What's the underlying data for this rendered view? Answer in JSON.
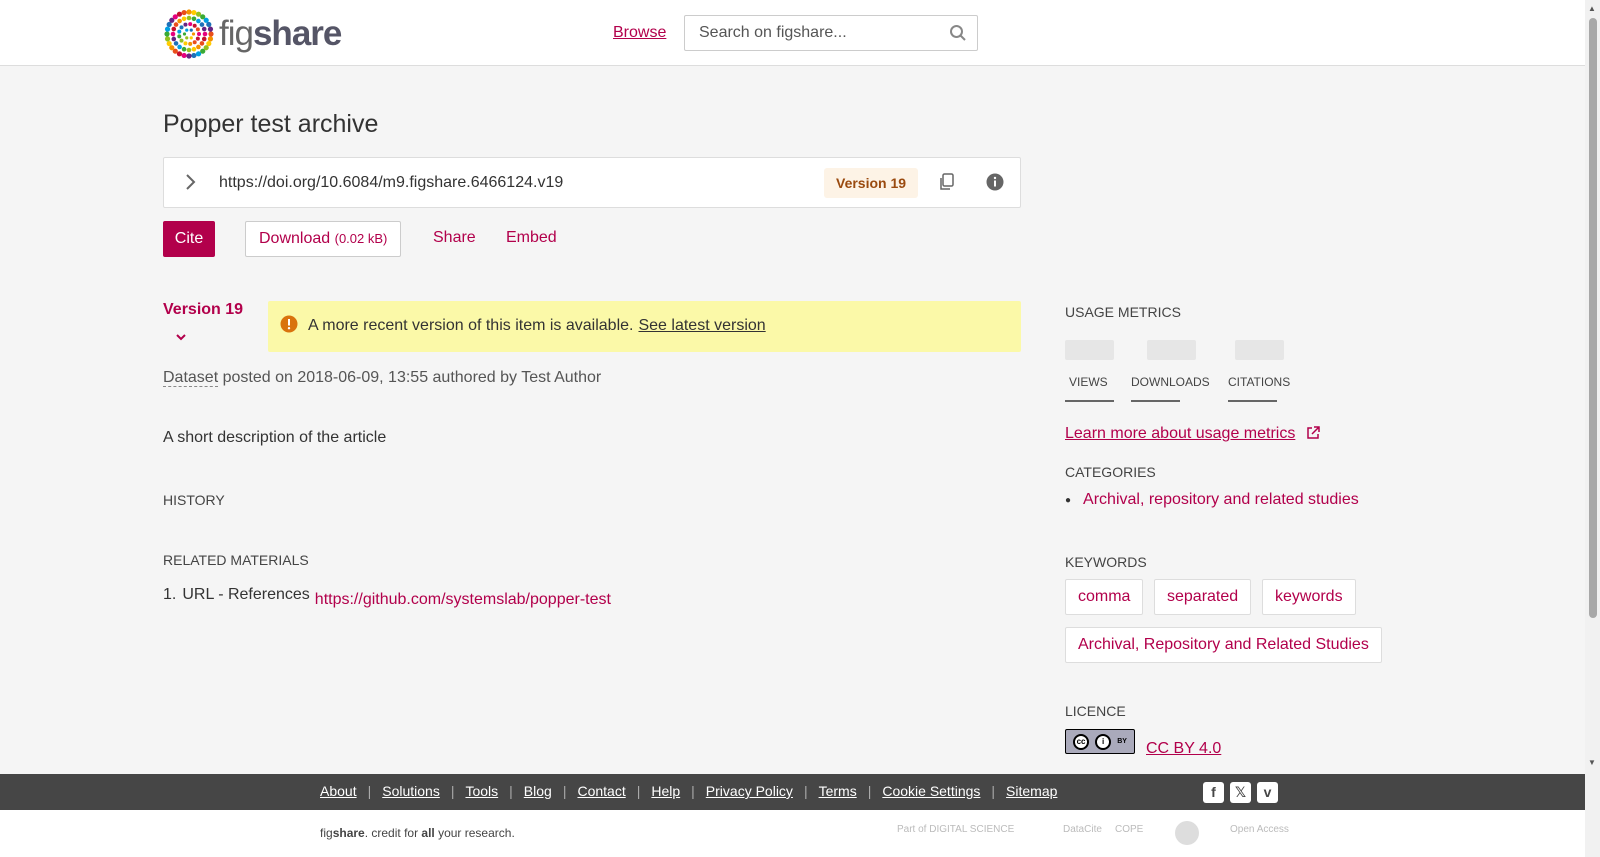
{
  "header": {
    "logo_text_light": "fig",
    "logo_text_bold": "share",
    "browse_label": "Browse",
    "search_placeholder": "Search on figshare..."
  },
  "item": {
    "title": "Popper test archive",
    "doi_url": "https://doi.org/10.6084/m9.figshare.6466124.v19",
    "version_badge": "Version 19"
  },
  "actions": {
    "cite_label": "Cite",
    "download_label": "Download",
    "download_size": "(0.02 kB)",
    "share_label": "Share",
    "embed_label": "Embed"
  },
  "version_selector": "Version 19",
  "alert": {
    "text": "A more recent version of this item is available.",
    "link": "See latest version"
  },
  "posted": {
    "type": "Dataset",
    "rest": " posted on 2018-06-09, 13:55 authored by Test Author"
  },
  "description": "A short description of the article",
  "history_heading": "HISTORY",
  "related": {
    "heading": "RELATED MATERIALS",
    "items": [
      {
        "num": "1.",
        "label": "URL - References",
        "url": "https://github.com/systemslab/popper-test"
      }
    ]
  },
  "usage": {
    "heading": "USAGE METRICS",
    "views": "VIEWS",
    "downloads": "DOWNLOADS",
    "citations": "CITATIONS",
    "learn_more": "Learn more about usage metrics"
  },
  "categories": {
    "heading": "CATEGORIES",
    "items": [
      "Archival, repository and related studies"
    ]
  },
  "keywords": {
    "heading": "KEYWORDS",
    "items": [
      "comma",
      "separated",
      "keywords",
      "Archival, Repository and Related Studies"
    ]
  },
  "licence": {
    "heading": "LICENCE",
    "name": "CC BY 4.0"
  },
  "footer": {
    "links": [
      "About",
      "Solutions",
      "Tools",
      "Blog",
      "Contact",
      "Help",
      "Privacy Policy",
      "Terms",
      "Cookie Settings",
      "Sitemap"
    ],
    "tagline_fig": "fig",
    "tagline_share": "share",
    "tagline_mid": ". credit for ",
    "tagline_all": "all",
    "tagline_end": " your research.",
    "partners": [
      "Part of DIGITAL SCIENCE",
      "DataCite",
      "COPE",
      "Open Access"
    ]
  },
  "colors": {
    "accent": "#b2004b",
    "alert_bg": "#fbf9a8",
    "footer_bg": "#464646",
    "version_badge_bg": "#fdf3e6"
  }
}
